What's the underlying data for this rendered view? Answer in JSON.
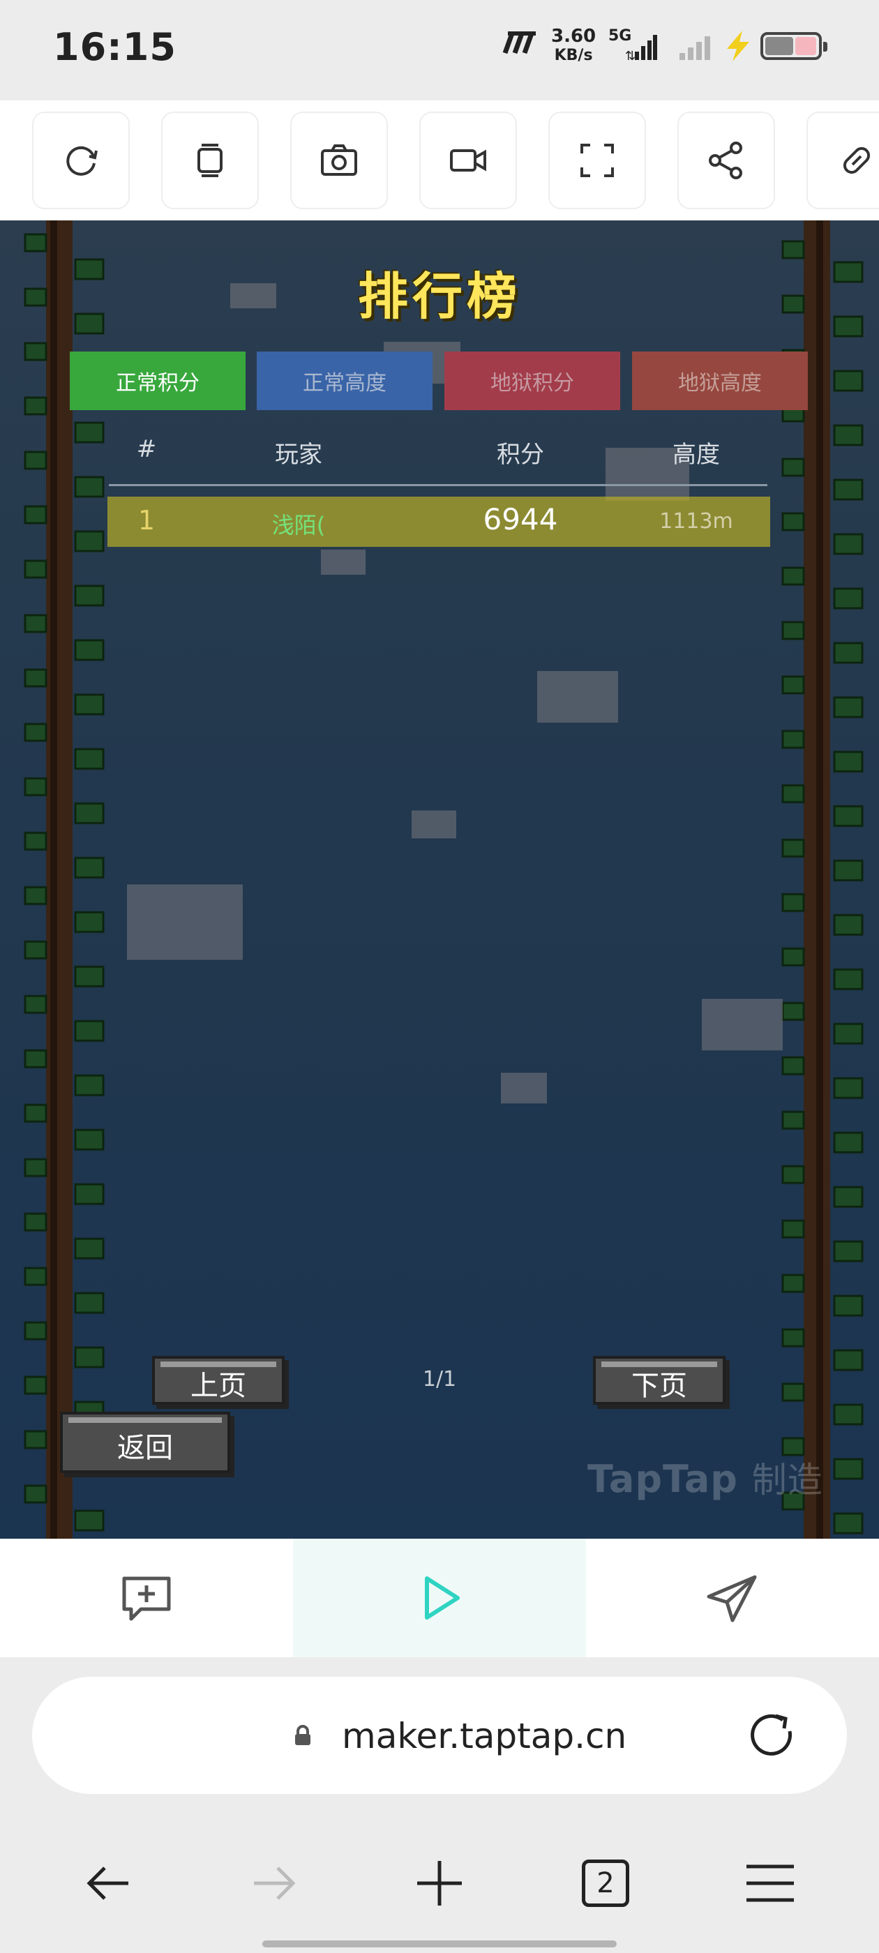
{
  "status_bar": {
    "time": "16:15",
    "speed_value": "3.60",
    "speed_unit": "KB/s",
    "network": "5G"
  },
  "toolbar": {
    "buttons": [
      {
        "name": "refresh",
        "icon": "refresh-icon"
      },
      {
        "name": "layers",
        "icon": "layers-icon"
      },
      {
        "name": "screenshot",
        "icon": "camera-icon"
      },
      {
        "name": "record",
        "icon": "video-icon"
      },
      {
        "name": "fullscreen",
        "icon": "fullscreen-icon"
      },
      {
        "name": "share",
        "icon": "share-icon"
      },
      {
        "name": "link",
        "icon": "link-icon"
      }
    ]
  },
  "game": {
    "title": "排行榜",
    "tabs": [
      {
        "label": "正常积分",
        "active": true,
        "color": "#38a83d"
      },
      {
        "label": "正常高度",
        "active": false,
        "color": "#3a64a8"
      },
      {
        "label": "地狱积分",
        "active": false,
        "color": "#a33c4a"
      },
      {
        "label": "地狱高度",
        "active": false,
        "color": "#96473f"
      }
    ],
    "columns": [
      "#",
      "玩家",
      "积分",
      "高度"
    ],
    "rows": [
      {
        "rank": "1",
        "player": "浅陌(",
        "score": "6944",
        "height": "1113m"
      }
    ],
    "prev_label": "上页",
    "next_label": "下页",
    "page_indicator": "1/1",
    "back_label": "返回",
    "watermark_brand": "TapTap",
    "watermark_suffix": "制造"
  },
  "action_bar": {
    "items": [
      {
        "name": "feedback",
        "icon": "comment-plus-icon"
      },
      {
        "name": "play",
        "icon": "play-icon",
        "active": true,
        "color": "#2fd3c2"
      },
      {
        "name": "send",
        "icon": "send-icon"
      }
    ]
  },
  "address_bar": {
    "url": "maker.taptap.cn"
  },
  "browser_nav": {
    "tab_count": "2"
  }
}
